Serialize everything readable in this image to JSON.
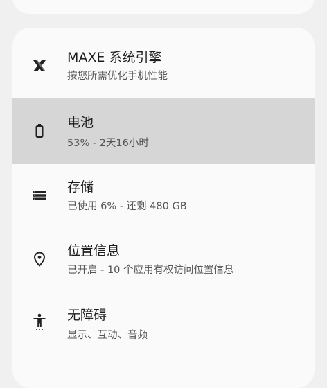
{
  "settings": {
    "items": [
      {
        "title": "MAXE 系统引擎",
        "subtitle": "按您所需优化手机性能",
        "icon": "maxe-x-icon"
      },
      {
        "title": "电池",
        "subtitle": "53% - 2天16小时",
        "icon": "battery-icon",
        "selected": true
      },
      {
        "title": "存储",
        "subtitle": "已使用 6% - 还剩 480 GB",
        "icon": "storage-icon"
      },
      {
        "title": "位置信息",
        "subtitle": "已开启 - 10 个应用有权访问位置信息",
        "icon": "location-pin-icon"
      },
      {
        "title": "无障碍",
        "subtitle": "显示、互动、音频",
        "icon": "accessibility-icon"
      }
    ]
  },
  "colors": {
    "background": "#f0f0f0",
    "card": "#fafafa",
    "selected": "#d6d6d6"
  }
}
